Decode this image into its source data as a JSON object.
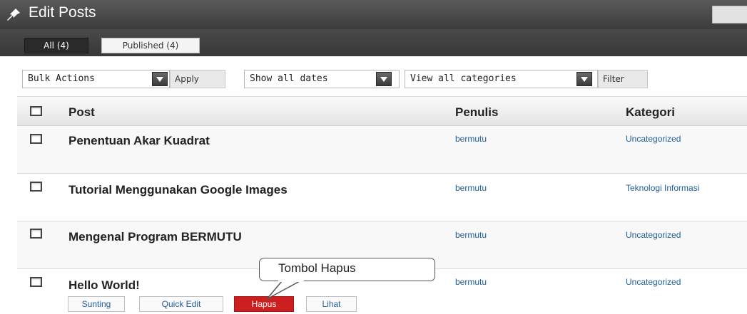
{
  "header": {
    "title": "Edit Posts",
    "icon": "pin-icon"
  },
  "tabs": [
    {
      "label": "All (4)",
      "active": true
    },
    {
      "label": "Published (4)",
      "active": false
    }
  ],
  "toolbar": {
    "bulk_actions": "Bulk Actions",
    "apply_label": "Apply",
    "dates_filter": "Show all dates",
    "categories_filter": "View all categories",
    "filter_label": "Filter"
  },
  "table": {
    "columns": [
      "Post",
      "Penulis",
      "Kategori"
    ],
    "rows": [
      {
        "title": "Penentuan Akar Kuadrat",
        "author": "bermutu",
        "category": "Uncategorized"
      },
      {
        "title": "Tutorial Menggunakan Google Images",
        "author": "bermutu",
        "category": "Teknologi Informasi"
      },
      {
        "title": "Mengenal Program BERMUTU",
        "author": "bermutu",
        "category": "Uncategorized"
      },
      {
        "title": "Hello World!",
        "author": "bermutu",
        "category": "Uncategorized"
      }
    ],
    "row_actions": [
      "Sunting",
      "Quick Edit",
      "Hapus",
      "Lihat"
    ]
  },
  "callout": {
    "text": "Tombol Hapus"
  },
  "colors": {
    "header_bg": "#474747",
    "link": "#1f5f9a",
    "delete_button": "#cc1f1f"
  }
}
